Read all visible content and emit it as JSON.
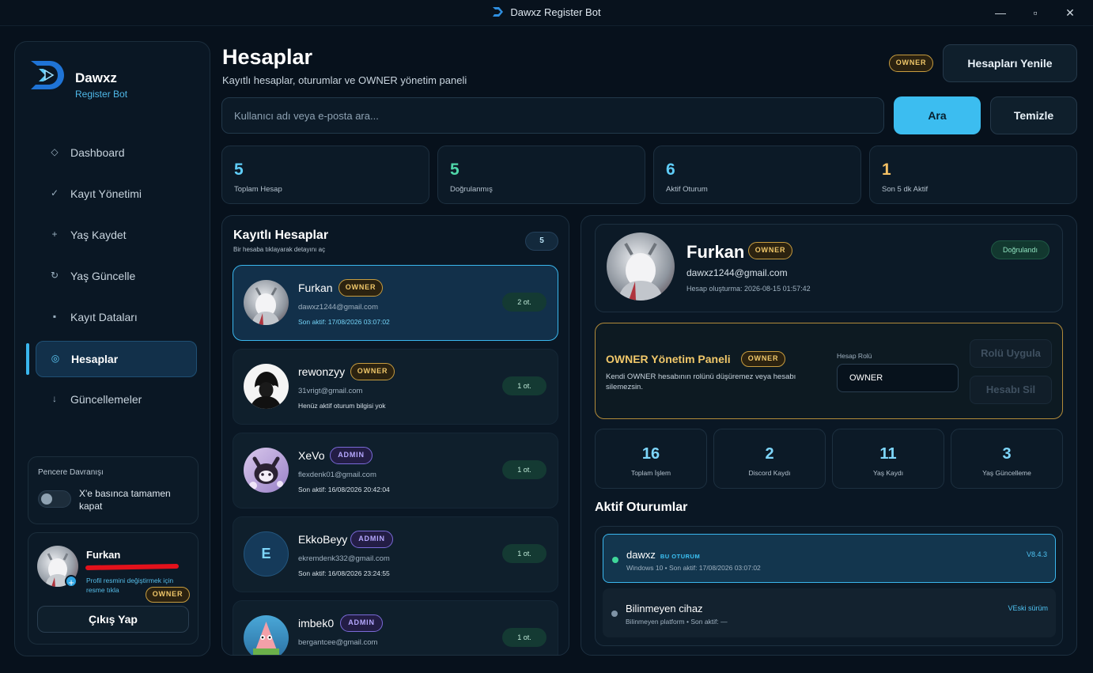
{
  "window": {
    "title": "Dawxz Register Bot",
    "minimize": "—",
    "maximize": "▫",
    "close": "✕"
  },
  "brand": {
    "name": "Dawxz",
    "subtitle": "Register Bot"
  },
  "nav": [
    {
      "label": "Dashboard",
      "icon": "◇",
      "icon_name": "diamond-icon"
    },
    {
      "label": "Kayıt Yönetimi",
      "icon": "✓",
      "icon_name": "check-icon"
    },
    {
      "label": "Yaş Kaydet",
      "icon": "+",
      "icon_name": "plus-icon"
    },
    {
      "label": "Yaş Güncelle",
      "icon": "↻",
      "icon_name": "refresh-icon"
    },
    {
      "label": "Kayıt Dataları",
      "icon": "▪",
      "icon_name": "square-icon"
    },
    {
      "label": "Hesaplar",
      "icon": "◎",
      "icon_name": "target-icon",
      "active": true
    },
    {
      "label": "Güncellemeler",
      "icon": "↓",
      "icon_name": "download-icon"
    }
  ],
  "window_behavior": {
    "title": "Pencere Davranışı",
    "toggle_label": "X'e basınca tamamen kapat",
    "enabled": false
  },
  "profile": {
    "name": "Furkan",
    "role": "OWNER",
    "hint": "Profil resmini değiştirmek için resme tıkla",
    "logout": "Çıkış Yap"
  },
  "header": {
    "title": "Hesaplar",
    "subtitle": "Kayıtlı hesaplar, oturumlar ve OWNER yönetim paneli",
    "role_badge": "OWNER",
    "refresh_button": "Hesapları Yenile"
  },
  "search": {
    "placeholder": "Kullanıcı adı veya e-posta ara...",
    "search_button": "Ara",
    "clear_button": "Temizle"
  },
  "stats": [
    {
      "value": "5",
      "label": "Toplam Hesap",
      "color": "#5fcdf8"
    },
    {
      "value": "5",
      "label": "Doğrulanmış",
      "color": "#4fd6a8"
    },
    {
      "value": "6",
      "label": "Aktif Oturum",
      "color": "#5fcdf8"
    },
    {
      "value": "1",
      "label": "Son 5 dk Aktif",
      "color": "#f3c064"
    }
  ],
  "accounts_panel": {
    "title": "Kayıtlı Hesaplar",
    "subtitle": "Bir hesaba tıklayarak detayını aç",
    "count": "5"
  },
  "accounts": [
    {
      "name": "Furkan",
      "role": "OWNER",
      "email": "dawxz1244@gmail.com",
      "status": "Son aktif: 17/08/2026 03:07:02",
      "sessions": "2 ot.",
      "selected": true,
      "avatar": "photo-grey"
    },
    {
      "name": "rewonzyy",
      "role": "OWNER",
      "email": "31vrigt@gmail.com",
      "status": "Henüz aktif oturum bilgisi yok",
      "sessions": "1 ot.",
      "avatar": "photo-dark"
    },
    {
      "name": "XeVo",
      "role": "ADMIN",
      "email": "flexdenk01@gmail.com",
      "status": "Son aktif: 16/08/2026 20:42:04",
      "sessions": "1 ot.",
      "avatar": "photo-purple"
    },
    {
      "name": "EkkoBeyy",
      "role": "ADMIN",
      "email": "ekremdenk332@gmail.com",
      "status": "Son aktif: 16/08/2026 23:24:55",
      "sessions": "1 ot.",
      "avatar": "letter",
      "letter": "E"
    },
    {
      "name": "imbek0",
      "role": "ADMIN",
      "email": "bergantcee@gmail.com",
      "status": "",
      "sessions": "1 ot.",
      "avatar": "photo-pink"
    }
  ],
  "detail": {
    "name": "Furkan",
    "role": "OWNER",
    "email": "dawxz1244@gmail.com",
    "created": "Hesap oluşturma: 2026-08-15 01:57:42",
    "verified": "Doğrulandı",
    "owner_panel": {
      "title": "OWNER Yönetim Paneli",
      "badge": "OWNER",
      "description": "Kendi OWNER hesabının rolünü düşüremez veya hesabı silemezsin.",
      "role_label": "Hesap Rolü",
      "role_value": "OWNER",
      "apply_button": "Rolü Uygula",
      "delete_button": "Hesabı Sil"
    },
    "stats": [
      {
        "value": "16",
        "label": "Toplam İşlem"
      },
      {
        "value": "2",
        "label": "Discord Kaydı"
      },
      {
        "value": "11",
        "label": "Yaş Kaydı"
      },
      {
        "value": "3",
        "label": "Yaş Güncelleme"
      }
    ],
    "sessions_title": "Aktif Oturumlar",
    "sessions": [
      {
        "name": "dawxz",
        "tag": "BU OTURUM",
        "meta": "Windows 10 • Son aktif: 17/08/2026 03:07:02",
        "version": "V8.4.3",
        "current": true,
        "dot_color": "#3fd69a"
      },
      {
        "name": "Bilinmeyen cihaz",
        "tag": "",
        "meta": "Bilinmeyen platform • Son aktif: —",
        "version": "VEski sürüm",
        "current": false,
        "dot_color": "#7f93a6"
      }
    ]
  }
}
